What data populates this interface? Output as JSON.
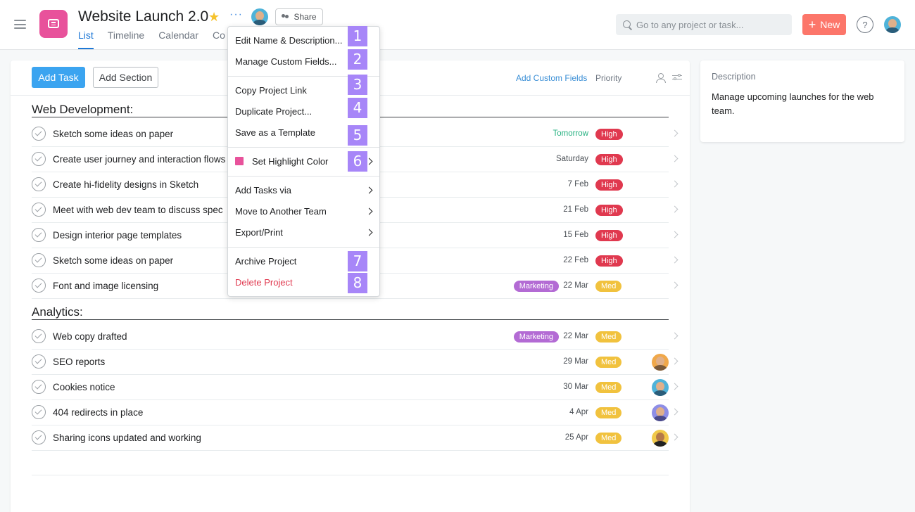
{
  "header": {
    "project_title": "Website Launch 2.0",
    "share_label": "Share",
    "tabs": [
      {
        "label": "List",
        "active": true
      },
      {
        "label": "Timeline",
        "active": false
      },
      {
        "label": "Calendar",
        "active": false
      },
      {
        "label": "Co",
        "active": false
      }
    ],
    "search_placeholder": "Go to any project or task...",
    "new_label": "New",
    "help_label": "?",
    "colors": {
      "project_icon": "#e8529b",
      "accent": "#1e78d6",
      "new_button": "#fc766a"
    }
  },
  "toolbar": {
    "add_task_label": "Add Task",
    "add_section_label": "Add Section",
    "add_custom_fields_label": "Add Custom Fields",
    "priority_label": "Priority"
  },
  "sections": [
    {
      "title": "Web Development:",
      "tasks": [
        {
          "name": "Sketch some ideas on paper",
          "due": "Tomorrow",
          "priority": "High"
        },
        {
          "name": "Create user journey and interaction flows",
          "due": "Saturday",
          "priority": "High"
        },
        {
          "name": "Create hi-fidelity designs in Sketch",
          "due": "7 Feb",
          "priority": "High"
        },
        {
          "name": "Meet with web dev team to discuss spec",
          "due": "21 Feb",
          "priority": "High"
        },
        {
          "name": "Design interior page templates",
          "due": "15 Feb",
          "priority": "High"
        },
        {
          "name": "Sketch some ideas on paper",
          "due": "22 Feb",
          "priority": "High"
        },
        {
          "name": "Font and image licensing",
          "tag": "Marketing",
          "due": "22 Mar",
          "priority": "Med"
        }
      ]
    },
    {
      "title": "Analytics:",
      "tasks": [
        {
          "name": "Web copy drafted",
          "tag": "Marketing",
          "due": "22 Mar",
          "priority": "Med"
        },
        {
          "name": "SEO reports",
          "due": "29 Mar",
          "priority": "Med"
        },
        {
          "name": "Cookies notice",
          "due": "30 Mar",
          "priority": "Med"
        },
        {
          "name": "404 redirects in place",
          "due": "4 Apr",
          "priority": "Med"
        },
        {
          "name": "Sharing icons updated and working",
          "due": "25 Apr",
          "priority": "Med"
        }
      ]
    }
  ],
  "description": {
    "label": "Description",
    "text": "Manage upcoming launches for the web team."
  },
  "menu": {
    "items": [
      {
        "label": "Edit Name & Description...",
        "badge": "1"
      },
      {
        "label": "Manage Custom Fields...",
        "badge": "2"
      },
      {
        "label": "Copy Project Link",
        "badge": "3"
      },
      {
        "label": "Duplicate Project...",
        "badge": "4"
      },
      {
        "label": "Save as a Template",
        "badge": "5"
      },
      {
        "label": "Set Highlight Color",
        "badge": "6"
      },
      {
        "label": "Add Tasks via"
      },
      {
        "label": "Move to Another Team"
      },
      {
        "label": "Export/Print"
      },
      {
        "label": "Archive Project",
        "badge": "7"
      },
      {
        "label": "Delete Project",
        "badge": "8"
      }
    ]
  }
}
